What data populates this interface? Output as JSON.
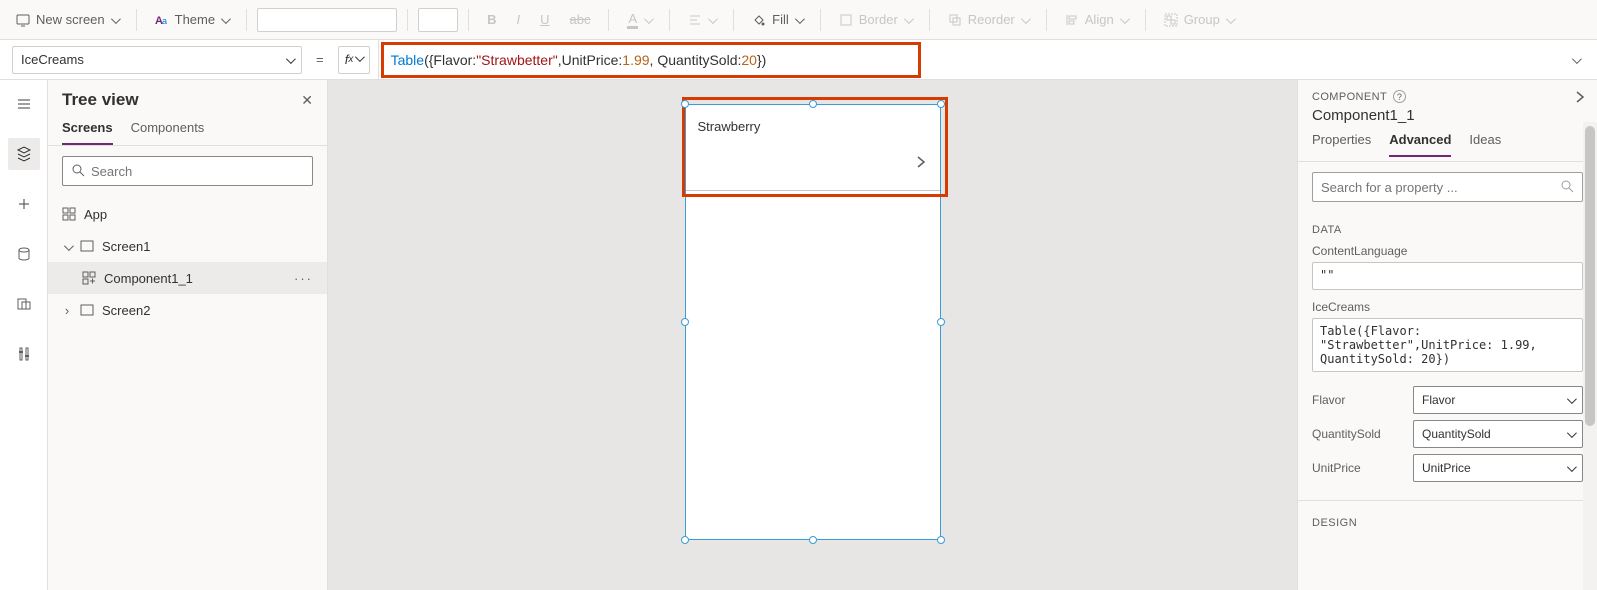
{
  "toolbar": {
    "new_screen": "New screen",
    "theme": "Theme",
    "fill": "Fill",
    "border": "Border",
    "reorder": "Reorder",
    "align": "Align",
    "group": "Group",
    "bold": "B",
    "italic": "I",
    "underline": "U"
  },
  "formulabar": {
    "property": "IceCreams",
    "fx": "fx",
    "formula_tokens": {
      "fn": "Table",
      "open": "({Flavor: ",
      "str": "\"Strawbetter\"",
      "mid1": ",UnitPrice: ",
      "num1": "1.99",
      "mid2": ", QuantitySold: ",
      "num2": "20",
      "close": "})"
    }
  },
  "tree": {
    "title": "Tree view",
    "tabs": {
      "screens": "Screens",
      "components": "Components"
    },
    "search_placeholder": "Search",
    "items": {
      "app": "App",
      "screen1": "Screen1",
      "component": "Component1_1",
      "screen2": "Screen2"
    }
  },
  "canvas": {
    "gallery_item_label": "Strawberry"
  },
  "rightpanel": {
    "kind": "COMPONENT",
    "name": "Component1_1",
    "tabs": {
      "properties": "Properties",
      "advanced": "Advanced",
      "ideas": "Ideas"
    },
    "search_placeholder": "Search for a property ...",
    "sections": {
      "data": "DATA",
      "design": "DESIGN"
    },
    "fields": {
      "content_language_label": "ContentLanguage",
      "content_language_value": "\"\"",
      "icecreams_label": "IceCreams",
      "icecreams_value": "Table({Flavor: \"Strawbetter\",UnitPrice: 1.99, QuantitySold: 20})",
      "flavor_label": "Flavor",
      "flavor_value": "Flavor",
      "quantity_label": "QuantitySold",
      "quantity_value": "QuantitySold",
      "unitprice_label": "UnitPrice",
      "unitprice_value": "UnitPrice"
    }
  }
}
